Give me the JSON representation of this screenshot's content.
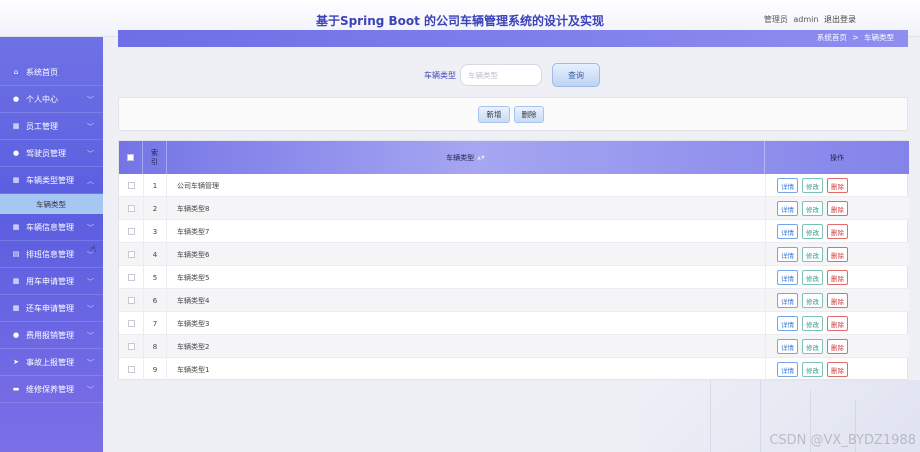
{
  "header": {
    "title": "基于Spring Boot 的公司车辆管理系统的设计及实现",
    "user_role": "管理员",
    "user_name": "admin",
    "logout": "退出登录"
  },
  "sidebar": {
    "items": [
      {
        "label": "系统首页",
        "icon": "home-icon",
        "has_chevron": false
      },
      {
        "label": "个人中心",
        "icon": "person-icon",
        "has_chevron": true
      },
      {
        "label": "员工管理",
        "icon": "grid-icon",
        "has_chevron": true
      },
      {
        "label": "驾驶员管理",
        "icon": "person-icon",
        "has_chevron": true
      },
      {
        "label": "车辆类型管理",
        "icon": "grid-icon",
        "has_chevron": true,
        "expanded": true
      },
      {
        "label": "车辆信息管理",
        "icon": "grid-icon",
        "has_chevron": true
      },
      {
        "label": "排班信息管理",
        "icon": "calendar-icon",
        "has_chevron": true
      },
      {
        "label": "用车申请管理",
        "icon": "grid-icon",
        "has_chevron": true
      },
      {
        "label": "还车申请管理",
        "icon": "grid-icon",
        "has_chevron": true
      },
      {
        "label": "费用报销管理",
        "icon": "location-icon",
        "has_chevron": true
      },
      {
        "label": "事故上报管理",
        "icon": "send-icon",
        "has_chevron": true
      },
      {
        "label": "维修保养管理",
        "icon": "chat-icon",
        "has_chevron": true
      }
    ],
    "active_sub": "车辆类型"
  },
  "breadcrumb": {
    "home": "系统首页",
    "separator": ">",
    "current": "车辆类型"
  },
  "search": {
    "label": "车辆类型",
    "placeholder": "车辆类型",
    "button": "查询"
  },
  "actions": {
    "add": "新增",
    "delete": "删除"
  },
  "table": {
    "headers": {
      "index": "索引",
      "type": "车辆类型",
      "ops": "操作"
    },
    "rows": [
      {
        "index": "1",
        "name": "公司车辆管理"
      },
      {
        "index": "2",
        "name": "车辆类型8"
      },
      {
        "index": "3",
        "name": "车辆类型7"
      },
      {
        "index": "4",
        "name": "车辆类型6"
      },
      {
        "index": "5",
        "name": "车辆类型5"
      },
      {
        "index": "6",
        "name": "车辆类型4"
      },
      {
        "index": "7",
        "name": "车辆类型3"
      },
      {
        "index": "8",
        "name": "车辆类型2"
      },
      {
        "index": "9",
        "name": "车辆类型1"
      }
    ],
    "op_labels": {
      "detail": "详情",
      "edit": "修改",
      "delete": "删除"
    }
  },
  "watermark": "CSDN @VX_BYDZ1988",
  "colors": {
    "accent": "#6e6ee6",
    "title": "#3b43b8",
    "delete": "#d03a3a",
    "edit": "#2e9a86",
    "detail": "#3d7ad8"
  }
}
